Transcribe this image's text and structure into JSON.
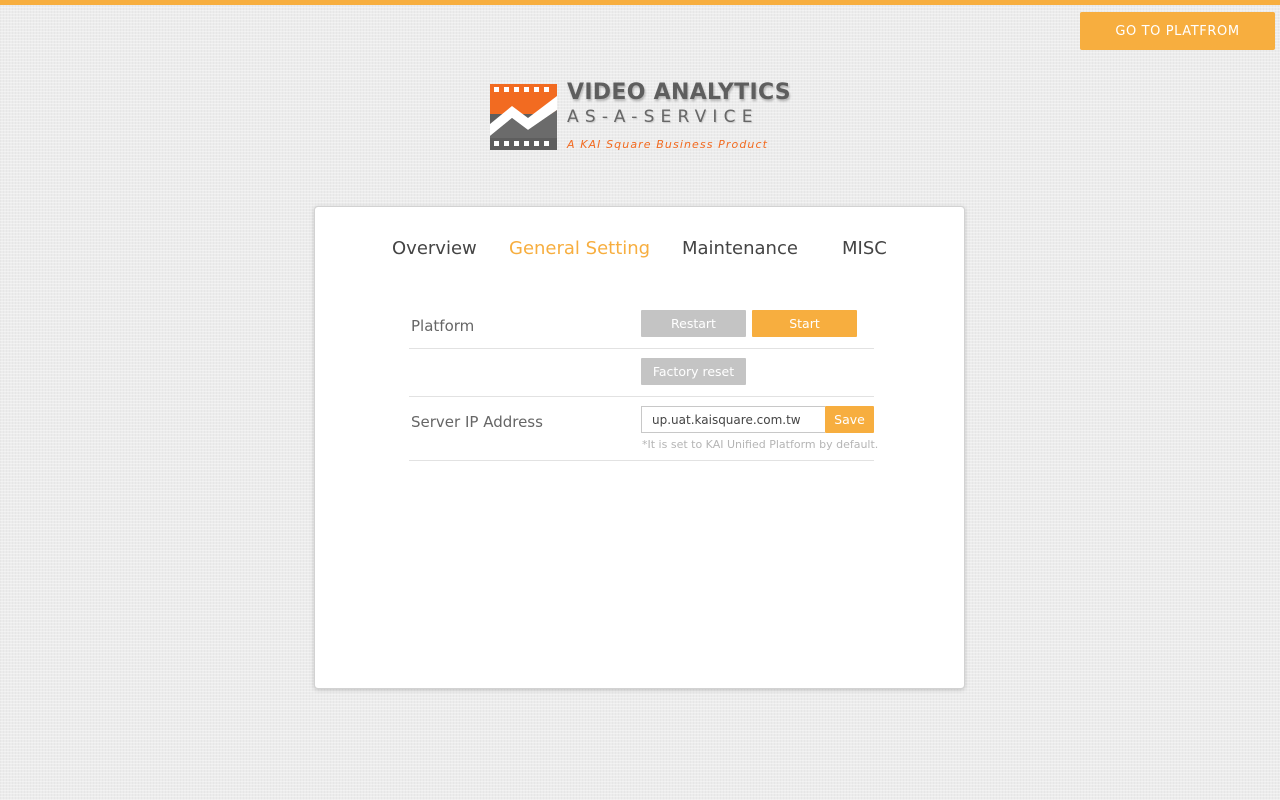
{
  "header": {
    "go_button_label": "GO TO PLATFROM",
    "accent_color": "#f7ae3f"
  },
  "logo": {
    "title": "VIDEO ANALYTICS",
    "subtitle": "AS-A-SERVICE",
    "tagline": "A KAI Square Business Product",
    "icon": "film-strip-chart-logo",
    "brand_orange": "#f26b21",
    "brand_gray": "#5e5e5e"
  },
  "tabs": [
    {
      "label": "Overview",
      "active": false
    },
    {
      "label": "General Setting",
      "active": true
    },
    {
      "label": "Maintenance",
      "active": false
    },
    {
      "label": "MISC",
      "active": false
    }
  ],
  "settings": {
    "platform": {
      "label": "Platform",
      "restart_label": "Restart",
      "start_label": "Start",
      "factory_reset_label": "Factory reset"
    },
    "server_ip": {
      "label": "Server IP Address",
      "value": "up.uat.kaisquare.com.tw",
      "save_label": "Save",
      "hint": "*It is set to KAI Unified Platform by default."
    }
  }
}
